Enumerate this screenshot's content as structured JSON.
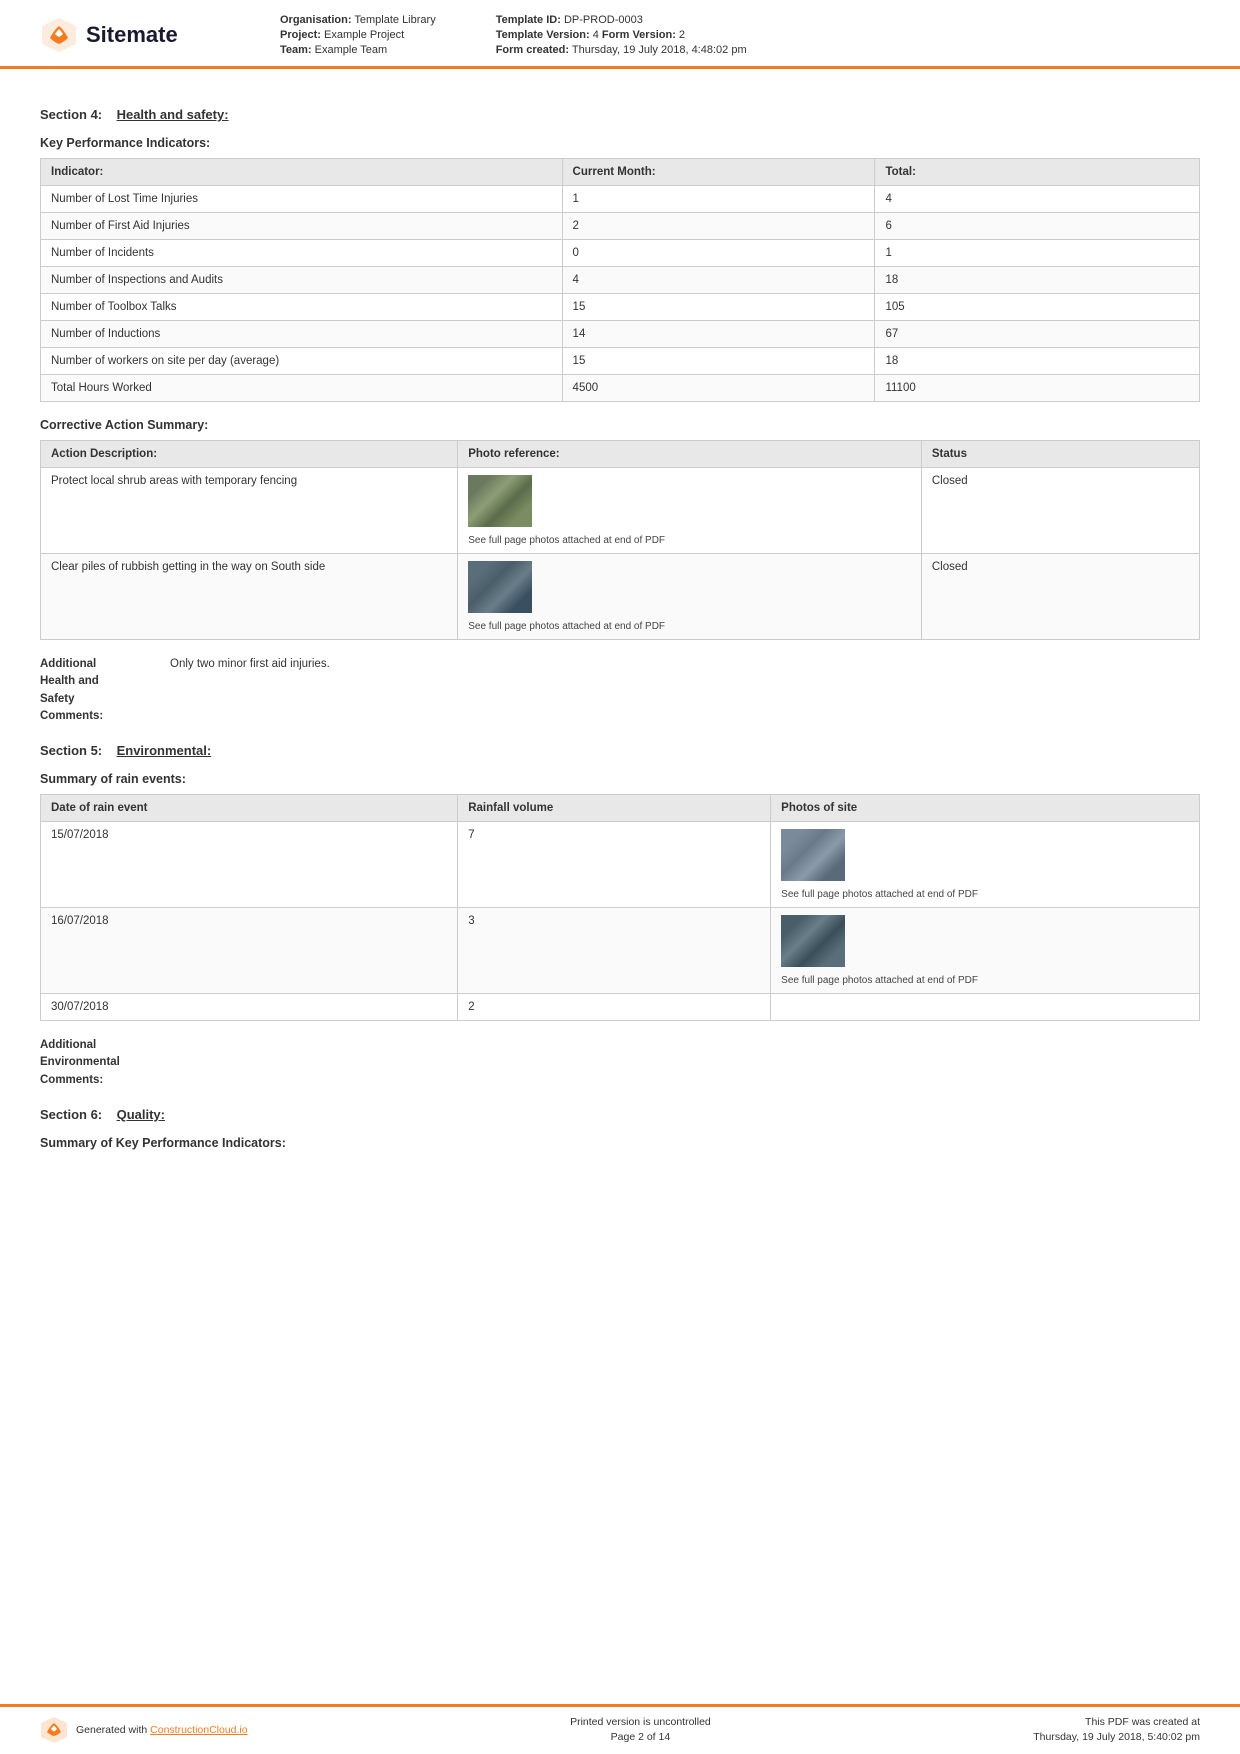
{
  "header": {
    "logo_text": "Sitemate",
    "org_label": "Organisation:",
    "org_value": "Template Library",
    "project_label": "Project:",
    "project_value": "Example Project",
    "team_label": "Team:",
    "team_value": "Example Team",
    "template_id_label": "Template ID:",
    "template_id_value": "DP-PROD-0003",
    "template_version_label": "Template Version:",
    "template_version_value": "4",
    "form_version_label": "Form Version:",
    "form_version_value": "2",
    "form_created_label": "Form created:",
    "form_created_value": "Thursday, 19 July 2018, 4:48:02 pm"
  },
  "section4": {
    "prefix": "Section 4:",
    "title": "Health and safety:"
  },
  "kpi": {
    "title": "Key Performance Indicators:",
    "headers": [
      "Indicator:",
      "Current Month:",
      "Total:"
    ],
    "rows": [
      [
        "Number of Lost Time Injuries",
        "1",
        "4"
      ],
      [
        "Number of First Aid Injuries",
        "2",
        "6"
      ],
      [
        "Number of Incidents",
        "0",
        "1"
      ],
      [
        "Number of Inspections and Audits",
        "4",
        "18"
      ],
      [
        "Number of Toolbox Talks",
        "15",
        "105"
      ],
      [
        "Number of Inductions",
        "14",
        "67"
      ],
      [
        "Number of workers on site per day (average)",
        "15",
        "18"
      ],
      [
        "Total Hours Worked",
        "4500",
        "11100"
      ]
    ]
  },
  "corrective_action": {
    "title": "Corrective Action Summary:",
    "headers": [
      "Action Description:",
      "Photo reference:",
      "Status"
    ],
    "rows": [
      {
        "description": "Protect local shrub areas with temporary fencing",
        "photo_caption": "See full page photos attached at end of PDF",
        "status": "Closed"
      },
      {
        "description": "Clear piles of rubbish getting in the way on South side",
        "photo_caption": "See full page photos attached at end of PDF",
        "status": "Closed"
      }
    ]
  },
  "additional_hs": {
    "label": "Additional\nHealth and\nSafety\nComments:",
    "value": "Only two minor first aid injuries."
  },
  "section5": {
    "prefix": "Section 5:",
    "title": "Environmental:"
  },
  "rain_events": {
    "title": "Summary of rain events:",
    "headers": [
      "Date of rain event",
      "Rainfall volume",
      "Photos of site"
    ],
    "rows": [
      {
        "date": "15/07/2018",
        "volume": "7",
        "photo_caption": "See full page photos attached at end of PDF"
      },
      {
        "date": "16/07/2018",
        "volume": "3",
        "photo_caption": "See full page photos attached at end of PDF"
      },
      {
        "date": "30/07/2018",
        "volume": "2",
        "photo_caption": ""
      }
    ]
  },
  "additional_env": {
    "label": "Additional\nEnvironmental\nComments:"
  },
  "section6": {
    "prefix": "Section 6:",
    "title": "Quality:"
  },
  "summary_kpi": {
    "title": "Summary of Key Performance Indicators:"
  },
  "footer": {
    "generated_text": "Generated with ",
    "link_text": "ConstructionCloud.io",
    "uncontrolled": "Printed version is uncontrolled",
    "page_info": "Page 2 of 14",
    "pdf_created_label": "This PDF was created at",
    "pdf_created_value": "Thursday, 19 July 2018, 5:40:02 pm"
  }
}
